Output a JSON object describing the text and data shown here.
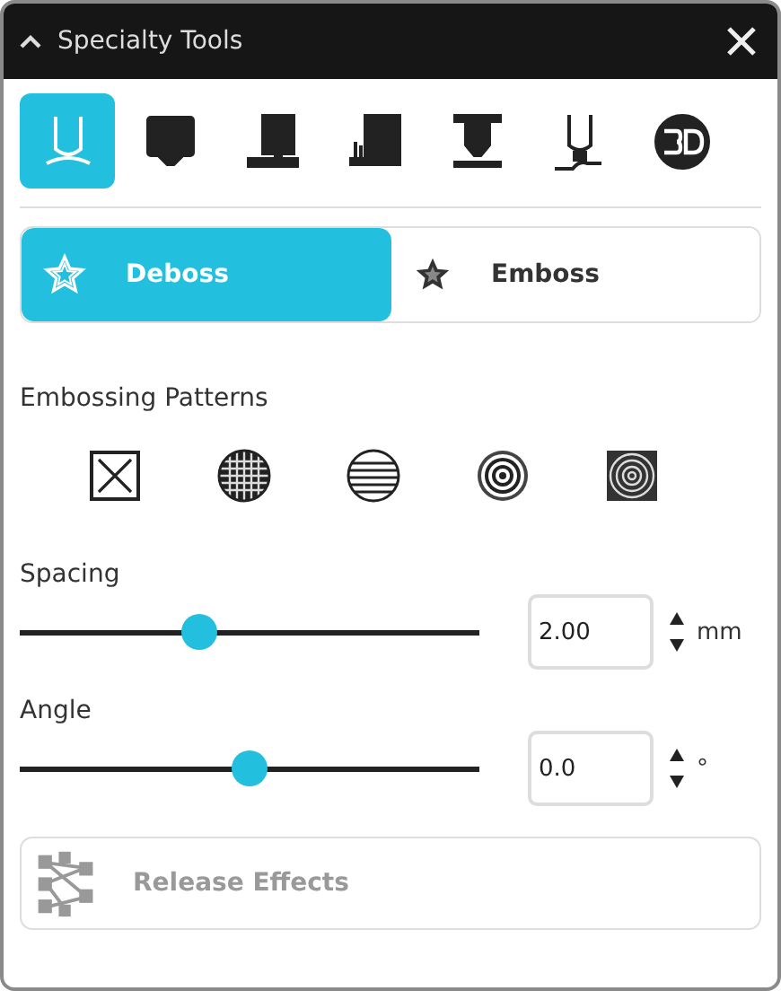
{
  "window": {
    "title": "Specialty Tools"
  },
  "tools": [
    {
      "selected": true
    },
    {
      "selected": false
    },
    {
      "selected": false
    },
    {
      "selected": false
    },
    {
      "selected": false
    },
    {
      "selected": false
    },
    {
      "selected": false
    }
  ],
  "modes": [
    {
      "label": "Deboss",
      "kind": "deboss",
      "selected": true
    },
    {
      "label": "Emboss",
      "kind": "emboss",
      "selected": false
    }
  ],
  "patterns": {
    "label": "Embossing Patterns",
    "items": [
      {
        "kind": "cross"
      },
      {
        "kind": "grid"
      },
      {
        "kind": "stripes"
      },
      {
        "kind": "rings"
      },
      {
        "kind": "square-rings"
      }
    ]
  },
  "settings": [
    {
      "label": "Spacing",
      "level": 0.39,
      "value": "2.00",
      "unit": "mm"
    },
    {
      "label": "Angle",
      "level": 0.5,
      "value": "0.0",
      "unit": "°"
    }
  ],
  "release": {
    "label": "Release Effects",
    "disabled": true
  }
}
